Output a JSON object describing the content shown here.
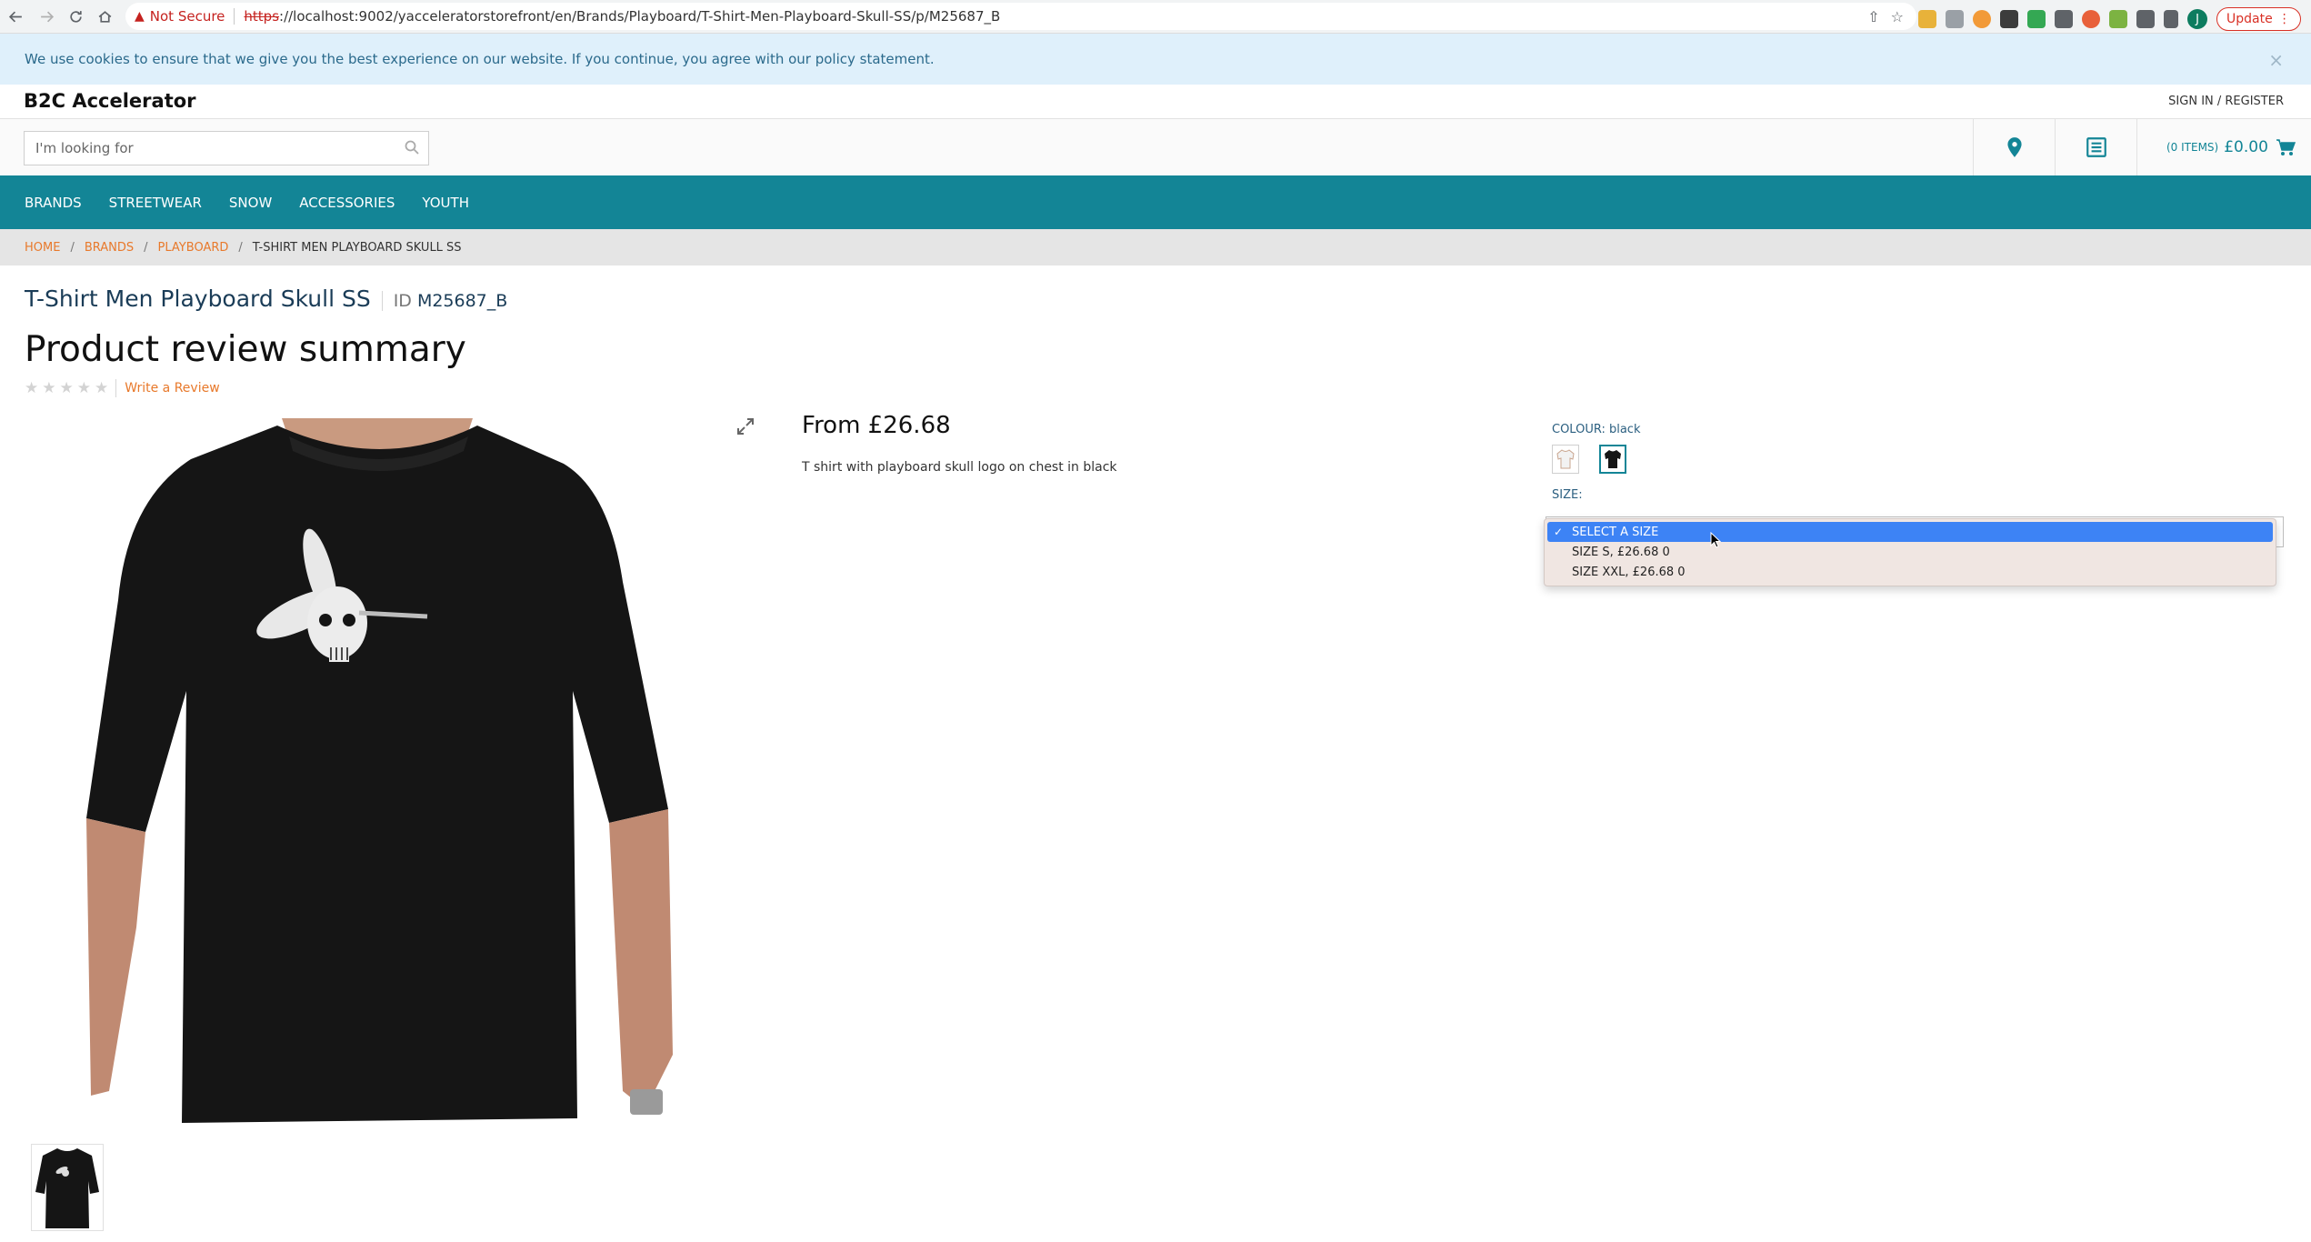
{
  "browser": {
    "security_label": "Not Secure",
    "url_scheme": "https",
    "url_rest": "://localhost:9002/yacceleratorstorefront/en/Brands/Playboard/T-Shirt-Men-Playboard-Skull-SS/p/M25687_B",
    "avatar_letter": "J",
    "update_label": "Update"
  },
  "cookie_banner": {
    "text": "We use cookies to ensure that we give you the best experience on our website. If you continue, you agree with our policy statement.",
    "close": "×"
  },
  "header": {
    "logo": "B2C Accelerator",
    "sign_in": "SIGN IN / REGISTER",
    "search_placeholder": "I'm looking for",
    "cart_items": "(0 ITEMS)",
    "cart_total": "£0.00"
  },
  "nav": {
    "items": [
      "BRANDS",
      "STREETWEAR",
      "SNOW",
      "ACCESSORIES",
      "YOUTH"
    ]
  },
  "breadcrumb": {
    "items": [
      "HOME",
      "BRANDS",
      "PLAYBOARD"
    ],
    "separator": "/",
    "current": "T-SHIRT MEN PLAYBOARD SKULL SS"
  },
  "product": {
    "title": "T-Shirt Men Playboard Skull SS",
    "id_label": "ID",
    "id_value": "M25687_B",
    "review_heading": "Product review summary",
    "rating": 0,
    "rating_max": 5,
    "write_review": "Write a Review",
    "price": "From £26.68",
    "description": "T shirt with playboard skull logo on chest in black",
    "colour_label": "COLOUR: black",
    "size_label": "SIZE:",
    "size_options": [
      {
        "label": "SELECT A SIZE",
        "selected": true
      },
      {
        "label": "SIZE S, £26.68  0",
        "selected": false
      },
      {
        "label": "SIZE XXL, £26.68  0",
        "selected": false
      }
    ],
    "colors": {
      "accent": "#138596",
      "link": "#e8792b",
      "tshirt": "#151515"
    }
  }
}
